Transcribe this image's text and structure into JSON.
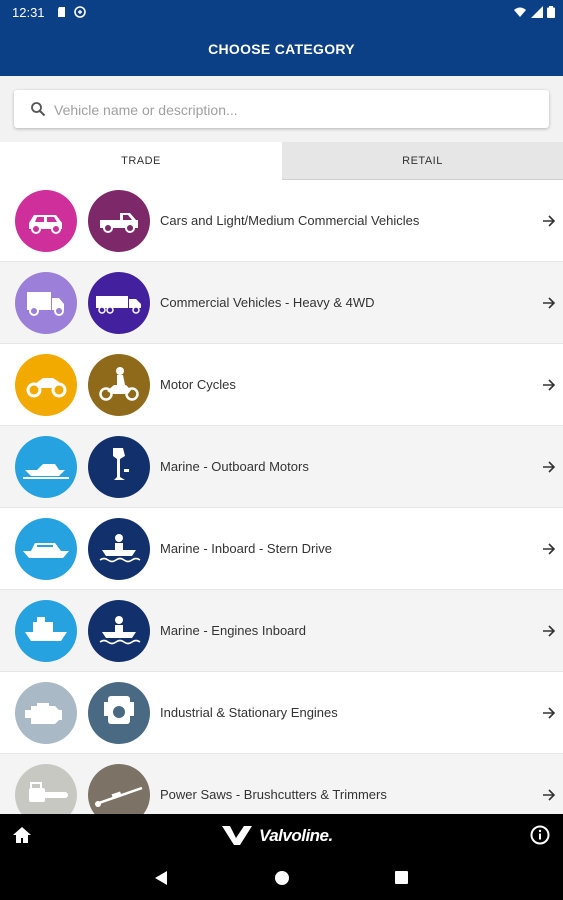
{
  "status": {
    "time": "12:31"
  },
  "header": {
    "title": "CHOOSE CATEGORY"
  },
  "search": {
    "placeholder": "Vehicle name or description..."
  },
  "tabs": [
    {
      "label": "TRADE"
    },
    {
      "label": "RETAIL"
    }
  ],
  "categories": [
    {
      "label": "Cars and Light/Medium Commercial Vehicles",
      "color_retail": "#cf2f9a",
      "color_trade": "#7c2869",
      "icon_retail": "car-icon",
      "icon_trade": "pickup-truck-icon"
    },
    {
      "label": "Commercial Vehicles - Heavy & 4WD",
      "color_retail": "#9b7fd8",
      "color_trade": "#43209e",
      "icon_retail": "box-truck-icon",
      "icon_trade": "semi-truck-icon"
    },
    {
      "label": "Motor Cycles",
      "color_retail": "#f2a900",
      "color_trade": "#8f6a1a",
      "icon_retail": "motorcycle-icon",
      "icon_trade": "motorcycle-rider-icon"
    },
    {
      "label": "Marine - Outboard Motors",
      "color_retail": "#26a2e0",
      "color_trade": "#12306b",
      "icon_retail": "speedboat-icon",
      "icon_trade": "outboard-motor-icon"
    },
    {
      "label": "Marine - Inboard - Stern Drive",
      "color_retail": "#26a2e0",
      "color_trade": "#12306b",
      "icon_retail": "cruiser-boat-icon",
      "icon_trade": "boat-driver-icon"
    },
    {
      "label": "Marine - Engines Inboard",
      "color_retail": "#26a2e0",
      "color_trade": "#12306b",
      "icon_retail": "ship-icon",
      "icon_trade": "boat-driver-icon"
    },
    {
      "label": "Industrial & Stationary Engines",
      "color_retail": "#aab9c6",
      "color_trade": "#4a6a83",
      "icon_retail": "engine-icon",
      "icon_trade": "engine-block-icon"
    },
    {
      "label": "Power Saws - Brushcutters & Trimmers",
      "color_retail": "#c8c8c3",
      "color_trade": "#7c7266",
      "icon_retail": "chainsaw-icon",
      "icon_trade": "trimmer-icon"
    }
  ],
  "footer": {
    "brand": "Valvoline."
  },
  "colors": {
    "primary": "#0b3f86",
    "bottom_bar": "#000000"
  }
}
